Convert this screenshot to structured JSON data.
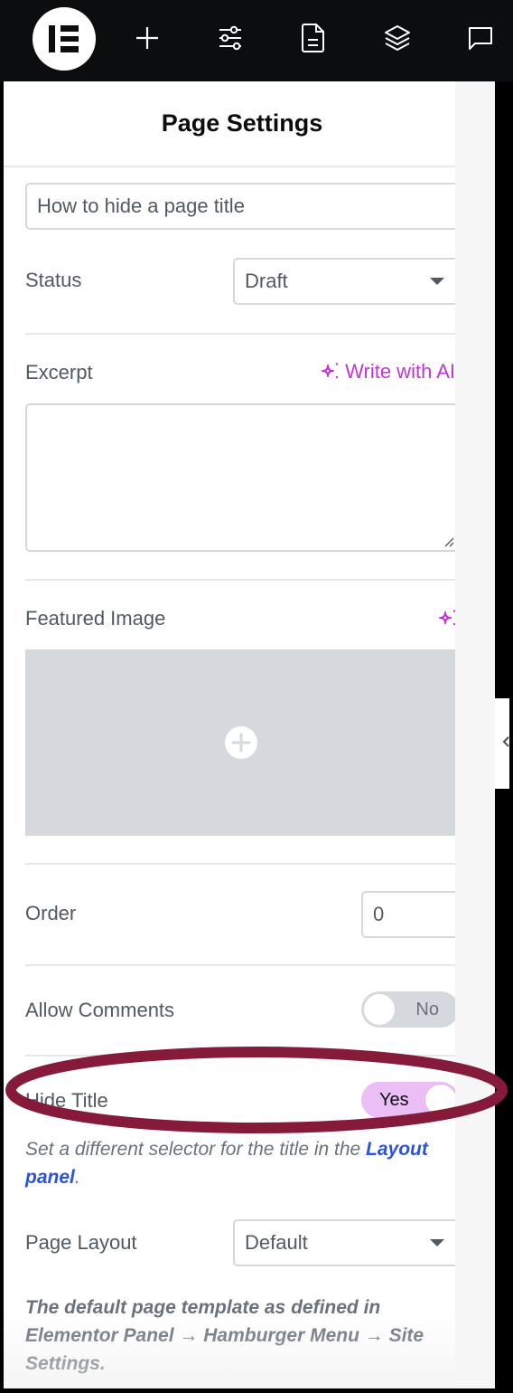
{
  "toolbar": {
    "items": [
      {
        "name": "elementor-logo",
        "icon": "elementor-logo-icon"
      },
      {
        "name": "add-element",
        "icon": "plus-icon"
      },
      {
        "name": "site-settings",
        "icon": "sliders-icon"
      },
      {
        "name": "page-settings",
        "icon": "document-icon"
      },
      {
        "name": "structure",
        "icon": "layers-icon"
      },
      {
        "name": "comments",
        "icon": "chat-bubble-icon"
      }
    ]
  },
  "panel": {
    "title": "Page Settings",
    "fields": {
      "title_value": "How to hide a page title",
      "status": {
        "label": "Status",
        "value": "Draft"
      },
      "excerpt": {
        "label": "Excerpt",
        "ai_label": "Write with AI",
        "value": ""
      },
      "featured_image": {
        "label": "Featured Image"
      },
      "order": {
        "label": "Order",
        "value": "0"
      },
      "allow_comments": {
        "label": "Allow Comments",
        "state": "No"
      },
      "hide_title": {
        "label": "Hide Title",
        "state": "Yes",
        "help_prefix": "Set a different selector for the title in the ",
        "help_link": "Layout panel",
        "help_suffix": "."
      },
      "page_layout": {
        "label": "Page Layout",
        "value": "Default",
        "help": "The default page template as defined in Elementor Panel → Hamburger Menu → Site Settings."
      }
    }
  },
  "colors": {
    "accent_ai": "#c036d4",
    "toggle_on": "#ebbff5",
    "link": "#2d54d8",
    "annotation": "#861a3b"
  }
}
